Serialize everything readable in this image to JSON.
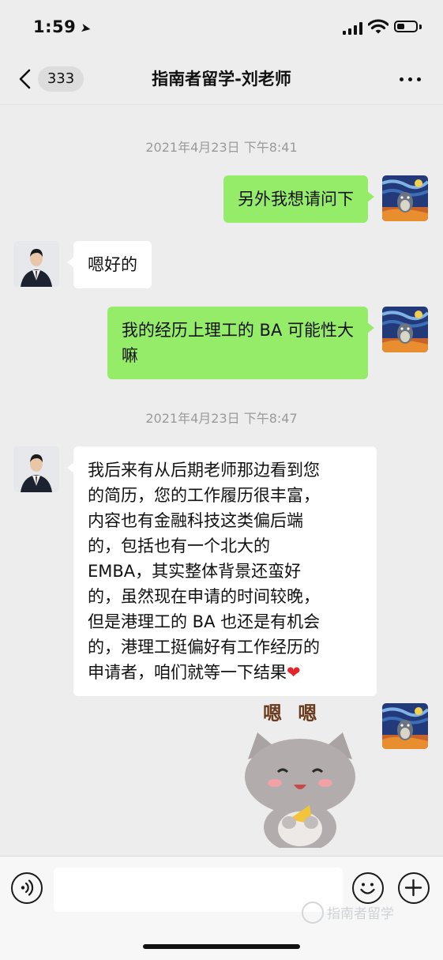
{
  "status_bar": {
    "time": "1:59"
  },
  "nav": {
    "unread_count": "333",
    "title": "指南者留学-刘老师"
  },
  "messages": [
    {
      "type": "timestamp",
      "text": "2021年4月23日 下午8:41"
    },
    {
      "type": "out",
      "lines": [
        "另外我想请问下"
      ]
    },
    {
      "type": "in",
      "lines": [
        "嗯好的"
      ]
    },
    {
      "type": "out",
      "lines": [
        "我的经历上理工的 BA 可能性大",
        "嘛"
      ]
    },
    {
      "type": "timestamp",
      "text": "2021年4月23日 下午8:47"
    },
    {
      "type": "in",
      "lines": [
        "我后来有从后期老师那边看到您",
        "的简历，您的工作履历很丰富，",
        "内容也有金融科技这类偏后端",
        "的，包括也有一个北大的",
        "EMBA，其实整体背景还蛮好",
        "的，虽然现在申请的时间较晚，",
        "但是港理工的 BA 也还是有机会",
        "的，港理工挺偏好有工作经历的",
        "申请者，咱们就等一下结果"
      ],
      "trailing_emoji": "❤"
    },
    {
      "type": "out-sticker",
      "sticker_text": "嗯 嗯"
    }
  ],
  "input_bar": {
    "placeholder": "",
    "watermark": "指南者留学"
  },
  "colors": {
    "outgoing_bubble": "#95ec69",
    "incoming_bubble": "#ffffff",
    "background": "#ededed"
  }
}
